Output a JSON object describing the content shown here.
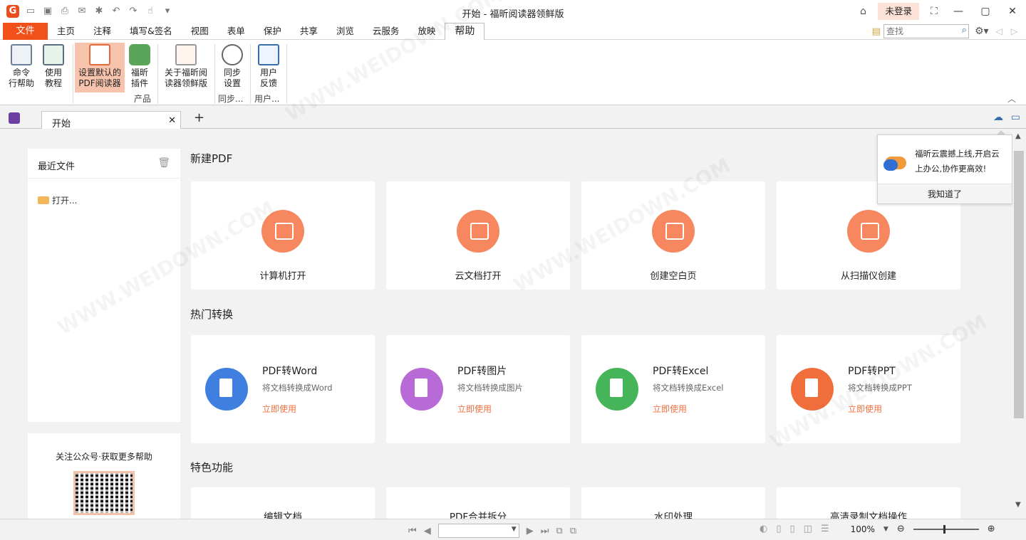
{
  "titlebar": {
    "title": "开始 - 福昕阅读器领鲜版",
    "login": "未登录",
    "logo": "G"
  },
  "menu": {
    "file": "文件",
    "tabs": [
      "主页",
      "注释",
      "填写&签名",
      "视图",
      "表单",
      "保护",
      "共享",
      "浏览",
      "云服务",
      "放映",
      "帮助"
    ],
    "active": "帮助",
    "search_placeholder": "查找"
  },
  "ribbon": {
    "buttons": [
      {
        "line1": "命令",
        "line2": "行帮助",
        "icon": "command-line-icon"
      },
      {
        "line1": "使用",
        "line2": "教程",
        "icon": "tutorial-video-icon"
      },
      {
        "line1": "设置默认的",
        "line2": "PDF阅读器",
        "icon": "default-reader-icon",
        "selected": true
      },
      {
        "line1": "福昕",
        "line2": "插件",
        "icon": "plugin-icon"
      },
      {
        "line1": "关于福昕阅",
        "line2": "读器领鲜版",
        "icon": "foxit-about-icon"
      },
      {
        "line1": "同步",
        "line2": "设置",
        "icon": "sync-settings-icon"
      },
      {
        "line1": "用户",
        "line2": "反馈",
        "icon": "feedback-icon"
      }
    ],
    "groups": {
      "product": "产品",
      "sync": "同步...",
      "user": "用户..."
    }
  },
  "tabs": {
    "doc_tab": "开始",
    "add": "+"
  },
  "left_panel": {
    "recent_title": "最近文件",
    "open_label": "打开...",
    "qr_title": "关注公众号·获取更多帮助"
  },
  "sections": {
    "new_pdf": "新建PDF",
    "hot_convert": "热门转换",
    "features": "特色功能"
  },
  "new_pdf_cards": [
    {
      "label": "计算机打开",
      "icon": "computer-icon"
    },
    {
      "label": "云文档打开",
      "icon": "cloud-icon"
    },
    {
      "label": "创建空白页",
      "icon": "blank-page-icon"
    },
    {
      "label": "从扫描仪创建",
      "icon": "scanner-icon"
    }
  ],
  "convert_cards": [
    {
      "title": "PDF转Word",
      "desc": "将文档转换成Word",
      "link": "立即使用",
      "color": "#3f7fe0",
      "icon": "word-icon"
    },
    {
      "title": "PDF转图片",
      "desc": "将文档转换成图片",
      "link": "立即使用",
      "color": "#b86ad6",
      "icon": "image-icon"
    },
    {
      "title": "PDF转Excel",
      "desc": "将文档转换成Excel",
      "link": "立即使用",
      "color": "#46b458",
      "icon": "excel-icon"
    },
    {
      "title": "PDF转PPT",
      "desc": "将文档转换成PPT",
      "link": "立即使用",
      "color": "#ef6e3c",
      "icon": "ppt-icon"
    }
  ],
  "feature_cards": [
    {
      "label": "编辑文档"
    },
    {
      "label": "PDF合并拆分"
    },
    {
      "label": "水印处理"
    },
    {
      "label": "高清录制文档操作"
    }
  ],
  "popup": {
    "text": "福昕云震撼上线,开启云上办公,协作更高效!",
    "button": "我知道了"
  },
  "statusbar": {
    "zoom": "100%"
  },
  "watermark": "WWW.WEIDOWN.COM"
}
